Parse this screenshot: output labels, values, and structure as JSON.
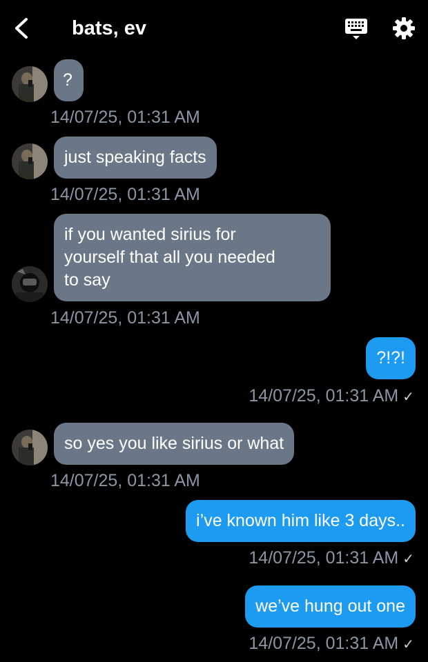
{
  "header": {
    "title": "bats, ev"
  },
  "messages": [
    {
      "direction": "in",
      "text": "?",
      "timestamp": "14/07/25, 01:31 AM"
    },
    {
      "direction": "in",
      "text": "just speaking facts",
      "timestamp": "14/07/25, 01:31 AM"
    },
    {
      "direction": "in",
      "lines": [
        "if you wanted sirius for",
        "yourself that all you needed",
        "to say"
      ],
      "timestamp": "14/07/25, 01:31 AM"
    },
    {
      "direction": "out",
      "text": "?!?!",
      "timestamp": "14/07/25, 01:31 AM",
      "status": "✓"
    },
    {
      "direction": "in",
      "text": "so yes you like sirius or what",
      "timestamp": "14/07/25, 01:31 AM"
    },
    {
      "direction": "out",
      "text": "i’ve known him like 3 days..",
      "timestamp": "14/07/25, 01:31 AM",
      "status": "✓"
    },
    {
      "direction": "out",
      "text": "we’ve hung out one",
      "timestamp": "14/07/25, 01:31 AM",
      "status": "✓"
    }
  ],
  "colors": {
    "incoming_bubble": "#6a7787",
    "outgoing_bubble": "#1d9bf0",
    "timestamp": "#8a96a3",
    "background": "#000000"
  },
  "icons": {
    "back": "chevron-left-icon",
    "keyboard": "keyboard-icon",
    "settings": "gear-icon"
  }
}
